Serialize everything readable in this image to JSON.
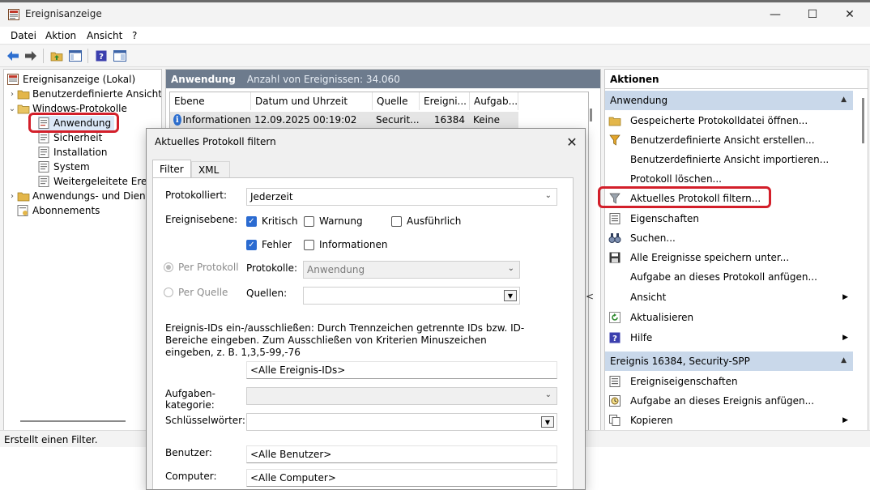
{
  "window": {
    "title": "Ereignisanzeige",
    "min_glyph": "—",
    "max_glyph": "☐",
    "close_glyph": "✕"
  },
  "menu": [
    "Datei",
    "Aktion",
    "Ansicht",
    "?"
  ],
  "toolbar": {
    "icons": [
      "back-arrow-icon",
      "forward-arrow-icon",
      "folder-up-icon",
      "show-hide-tree-icon",
      "help-icon",
      "properties-icon"
    ]
  },
  "tree": {
    "root": "Ereignisanzeige (Lokal)",
    "custom_views": "Benutzerdefinierte Ansichten",
    "windows_logs": "Windows-Protokolle",
    "application": "Anwendung",
    "security": "Sicherheit",
    "installation": "Installation",
    "system": "System",
    "forwarded": "Weitergeleitete Ereignisse",
    "app_services": "Anwendungs- und Dienstprotokolle",
    "subscriptions": "Abonnements"
  },
  "center": {
    "title": "Anwendung",
    "count": "Anzahl von Ereignissen: 34.060",
    "columns": [
      "Ebene",
      "Datum und Uhrzeit",
      "Quelle",
      "Ereigni...",
      "Aufgab..."
    ],
    "row": {
      "level": "Informationen",
      "date": "12.09.2025 00:19:02",
      "source": "Securit...",
      "id": "16384",
      "task": "Keine"
    },
    "partial_glyph": "<"
  },
  "actions": {
    "title": "Aktionen",
    "section1": "Anwendung",
    "items1": [
      "Gespeicherte Protokolldatei öffnen...",
      "Benutzerdefinierte Ansicht erstellen...",
      "Benutzerdefinierte Ansicht importieren...",
      "Protokoll löschen...",
      "Aktuelles Protokoll filtern...",
      "Eigenschaften",
      "Suchen...",
      "Alle Ereignisse speichern unter...",
      "Aufgabe an dieses Protokoll anfügen...",
      "Ansicht",
      "Aktualisieren",
      "Hilfe"
    ],
    "section2": "Ereignis 16384, Security-SPP",
    "items2": [
      "Ereigniseigenschaften",
      "Aufgabe an dieses Ereignis anfügen...",
      "Kopieren"
    ]
  },
  "status": {
    "text": "Erstellt einen Filter."
  },
  "dialog": {
    "title": "Aktuelles Protokoll filtern",
    "tabs": [
      "Filter",
      "XML"
    ],
    "logged_label": "Protokolliert:",
    "logged_value": "Jederzeit",
    "level_label": "Ereignisebene:",
    "levels": {
      "critical": "Kritisch",
      "warning": "Warnung",
      "verbose": "Ausführlich",
      "error": "Fehler",
      "information": "Informationen"
    },
    "by_log": "Per Protokoll",
    "by_source": "Per Quelle",
    "logs_label": "Protokolle:",
    "logs_value": "Anwendung",
    "sources_label": "Quellen:",
    "ids_help": "Ereignis-IDs ein-/ausschließen: Durch Trennzeichen getrennte IDs bzw. ID-Bereiche eingeben. Zum Ausschließen von Kriterien Minuszeichen eingeben, z. B. 1,3,5-99,-76",
    "ids_value": "<Alle Ereignis-IDs>",
    "task_label": "Aufgaben-kategorie:",
    "keywords_label": "Schlüsselwörter:",
    "user_label": "Benutzer:",
    "user_value": "<Alle Benutzer>",
    "computer_label": "Computer:",
    "computer_value": "<Alle Computer>"
  }
}
